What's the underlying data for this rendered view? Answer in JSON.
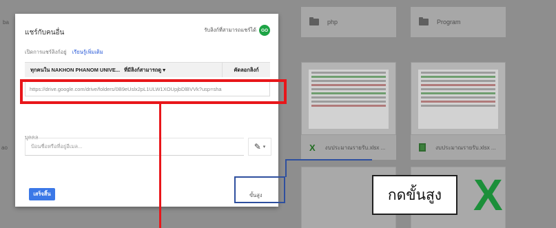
{
  "background": {
    "left_edge_labels": [
      "ba",
      "ao"
    ],
    "folders": [
      {
        "name": "php",
        "icon": "folder-icon"
      },
      {
        "name": "Program",
        "icon": "folder-icon"
      }
    ],
    "files": [
      {
        "name": "งบประมาณรายรับ.xlsx ...",
        "icon": "excel-x-icon"
      },
      {
        "name": "งบประมาณรายรับ.xlsx ...",
        "icon": "sheets-icon"
      }
    ],
    "big_file_icon": "X"
  },
  "dialog": {
    "title": "แชร์กับคนอื่น",
    "account_text": "รับลิงก์ที่สามารถแชร์ได้",
    "avatar_initials": "GO",
    "link_sharing_label": "เปิดการแชร์ลิงก์อยู่",
    "learn_more": "เรียนรู้เพิ่มเติม",
    "permission_scope": "ทุกคนใน NAKHON PHANOM UNIVE...",
    "permission_level": "ที่มีลิงก์สามารถดู ▾",
    "copy_link": "คัดลอกลิงก์",
    "share_url": "https://drive.google.com/drive/folders/0B9eUslx2pL1ULW1XOUpjbDlBVVk?usp=sha",
    "people_label": "บุคคล",
    "people_placeholder": "ป้อนชื่อหรือที่อยู่อีเมล...",
    "edit_icon": "✎",
    "done_button": "เสร็จสิ้น",
    "advanced_link": "ขั้นสูง"
  },
  "annotation": {
    "callout_text": "กดขั้นสูง",
    "colors": {
      "red": "#e8161a",
      "blue": "#2e4f9e"
    }
  }
}
